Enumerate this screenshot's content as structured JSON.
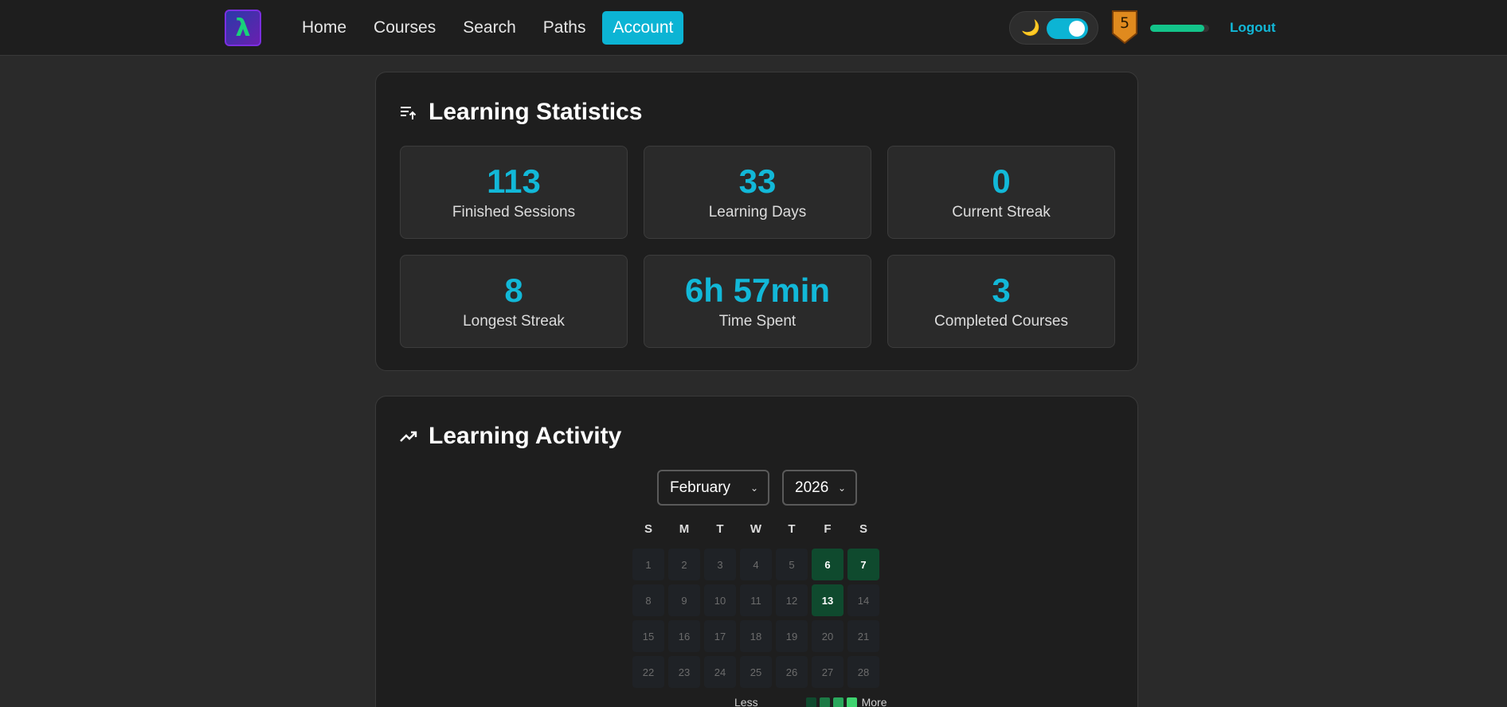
{
  "nav": {
    "logo_glyph": "λ",
    "items": [
      {
        "label": "Home",
        "active": false
      },
      {
        "label": "Courses",
        "active": false
      },
      {
        "label": "Search",
        "active": false
      },
      {
        "label": "Paths",
        "active": false
      },
      {
        "label": "Account",
        "active": true
      }
    ],
    "theme_icon": "🌙",
    "dark_mode": true,
    "level": "5",
    "xp_progress": 0.92,
    "logout_label": "Logout"
  },
  "stats": {
    "title": "Learning Statistics",
    "icon": "sort-up-icon",
    "items": [
      {
        "value": "113",
        "label": "Finished Sessions"
      },
      {
        "value": "33",
        "label": "Learning Days"
      },
      {
        "value": "0",
        "label": "Current Streak"
      },
      {
        "value": "8",
        "label": "Longest Streak"
      },
      {
        "value": "6h 57min",
        "label": "Time Spent"
      },
      {
        "value": "3",
        "label": "Completed Courses"
      }
    ]
  },
  "activity": {
    "title": "Learning Activity",
    "icon": "trending-up-icon",
    "month": "February",
    "year": "2026",
    "weekdays": [
      "S",
      "M",
      "T",
      "W",
      "T",
      "F",
      "S"
    ],
    "days": [
      {
        "d": "1",
        "active": false
      },
      {
        "d": "2",
        "active": false
      },
      {
        "d": "3",
        "active": false
      },
      {
        "d": "4",
        "active": false
      },
      {
        "d": "5",
        "active": false
      },
      {
        "d": "6",
        "active": true
      },
      {
        "d": "7",
        "active": true
      },
      {
        "d": "8",
        "active": false
      },
      {
        "d": "9",
        "active": false
      },
      {
        "d": "10",
        "active": false
      },
      {
        "d": "11",
        "active": false
      },
      {
        "d": "12",
        "active": false
      },
      {
        "d": "13",
        "active": true
      },
      {
        "d": "14",
        "active": false
      },
      {
        "d": "15",
        "active": false
      },
      {
        "d": "16",
        "active": false
      },
      {
        "d": "17",
        "active": false
      },
      {
        "d": "18",
        "active": false
      },
      {
        "d": "19",
        "active": false
      },
      {
        "d": "20",
        "active": false
      },
      {
        "d": "21",
        "active": false
      },
      {
        "d": "22",
        "active": false
      },
      {
        "d": "23",
        "active": false
      },
      {
        "d": "24",
        "active": false
      },
      {
        "d": "25",
        "active": false
      },
      {
        "d": "26",
        "active": false
      },
      {
        "d": "27",
        "active": false
      },
      {
        "d": "28",
        "active": false
      }
    ],
    "legend_less": "Less",
    "legend_more": "More",
    "legend_colors": [
      "#0f4a2e",
      "#1c7a45",
      "#2aa85c",
      "#3fd470"
    ]
  }
}
